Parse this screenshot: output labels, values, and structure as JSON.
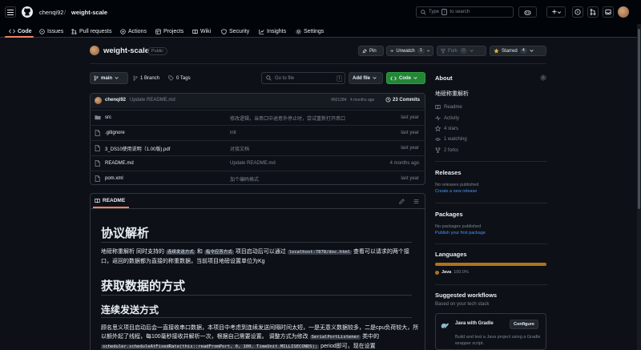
{
  "header": {
    "owner": "chenqi92",
    "separator": "/",
    "repo": "weight-scale",
    "search_prefix": "Type",
    "search_key": "/",
    "search_suffix": "to search"
  },
  "nav": {
    "tabs": [
      "Code",
      "Issues",
      "Pull requests",
      "Actions",
      "Projects",
      "Wiki",
      "Security",
      "Insights",
      "Settings"
    ]
  },
  "repo_bar": {
    "name": "weight-scale",
    "visibility": "Public",
    "pin": "Pin",
    "unwatch": "Unwatch",
    "watch_count": "1",
    "fork": "Fork",
    "fork_count": "0",
    "starred": "Starred",
    "star_count": "4"
  },
  "toolbar": {
    "branch": "main",
    "branches": "1 Branch",
    "tags": "0 Tags",
    "goto_placeholder": "Go to file",
    "goto_key": "t",
    "add_file": "Add file",
    "code": "Code"
  },
  "commit": {
    "author": "chenqi92",
    "message": "Update README.md",
    "hash": "4501284",
    "time": "4 months ago",
    "count": "23 Commits"
  },
  "files": [
    {
      "name": "src",
      "type": "dir",
      "message": "修改逻辑，当串口中途意外停止时，尝试重新打开串口",
      "time": "last year"
    },
    {
      "name": ".gitignore",
      "type": "file",
      "message": "init",
      "time": "last year"
    },
    {
      "name": "3_DS10使用说明（1.00版).pdf",
      "type": "file",
      "message": "对接文档",
      "time": "last year"
    },
    {
      "name": "README.md",
      "type": "file",
      "message": "Update README.md",
      "time": "4 months ago"
    },
    {
      "name": "pom.xml",
      "type": "file",
      "message": "加个编码格式",
      "time": "last year"
    }
  ],
  "readme": {
    "tab": "README",
    "h1": "协议解析",
    "p1_a": "地磅称重解析 同时支持的",
    "p1_code1": "连续发送方式",
    "p1_b": "和",
    "p1_code2": "指令应答方式",
    "p1_c": "项目启动后可以通过",
    "p1_code3": "localhost:7878/doc.html",
    "p1_d": "查看可以请求的两个接口，返回的数据都为直接的称重数据，当前项目地磅设置单位为Kg",
    "h1b": "获取数据的方式",
    "h2": "连续发送方式",
    "p2_a": "顾名思义项目启动后会一直接收串口数据，本项目中考虑到连续发送间隔时间太短，一是无意义数据较多，二是cpu负荷较大，所以额外起了线程，每100毫秒接收并解析一次，根据自己需要设置。 调整方式为修改",
    "p2_code1": "SerialPortListener",
    "p2_b": "类中的",
    "p2_code2": "scheduler.scheduleAtFixedRate(this::readFromPort, 0, 100, TimeUnit.MILLISECONDS);",
    "p2_c": "period即可，现在设置"
  },
  "sidebar": {
    "about": "About",
    "description": "地磅称重解析",
    "items": [
      "Readme",
      "Activity",
      "4 stars",
      "1 watching",
      "2 forks"
    ],
    "releases_title": "Releases",
    "releases_none": "No releases published",
    "releases_link": "Create a new release",
    "packages_title": "Packages",
    "packages_none": "No packages published",
    "packages_link": "Publish your first package",
    "languages_title": "Languages",
    "language_name": "Java",
    "language_pct": "100.0%",
    "workflows_title": "Suggested workflows",
    "workflows_sub": "Based on your tech stack",
    "workflow_name": "Java with Gradle",
    "workflow_btn": "Configure",
    "workflow_desc": "Build and test a Java project using a Gradle wrapper script."
  },
  "colors": {
    "java": "#b07219",
    "green": "#238636",
    "accent": "#f78166",
    "star": "#e3b341"
  }
}
